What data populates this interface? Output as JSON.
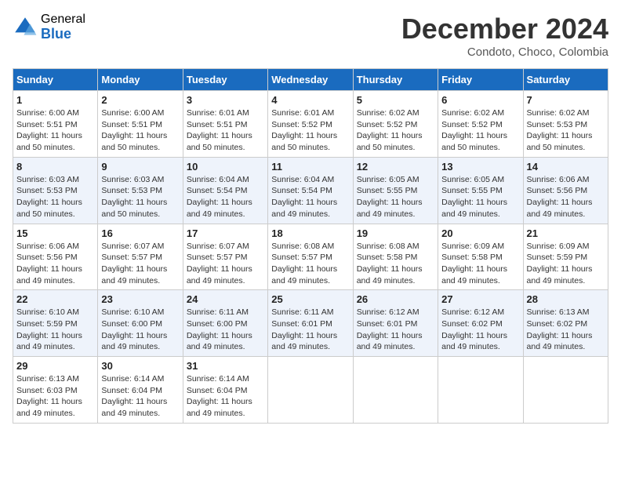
{
  "logo": {
    "general": "General",
    "blue": "Blue"
  },
  "header": {
    "month": "December 2024",
    "location": "Condoto, Choco, Colombia"
  },
  "weekdays": [
    "Sunday",
    "Monday",
    "Tuesday",
    "Wednesday",
    "Thursday",
    "Friday",
    "Saturday"
  ],
  "weeks": [
    [
      {
        "day": "1",
        "sunrise": "6:00 AM",
        "sunset": "5:51 PM",
        "daylight": "11 hours and 50 minutes."
      },
      {
        "day": "2",
        "sunrise": "6:00 AM",
        "sunset": "5:51 PM",
        "daylight": "11 hours and 50 minutes."
      },
      {
        "day": "3",
        "sunrise": "6:01 AM",
        "sunset": "5:51 PM",
        "daylight": "11 hours and 50 minutes."
      },
      {
        "day": "4",
        "sunrise": "6:01 AM",
        "sunset": "5:52 PM",
        "daylight": "11 hours and 50 minutes."
      },
      {
        "day": "5",
        "sunrise": "6:02 AM",
        "sunset": "5:52 PM",
        "daylight": "11 hours and 50 minutes."
      },
      {
        "day": "6",
        "sunrise": "6:02 AM",
        "sunset": "5:52 PM",
        "daylight": "11 hours and 50 minutes."
      },
      {
        "day": "7",
        "sunrise": "6:02 AM",
        "sunset": "5:53 PM",
        "daylight": "11 hours and 50 minutes."
      }
    ],
    [
      {
        "day": "8",
        "sunrise": "6:03 AM",
        "sunset": "5:53 PM",
        "daylight": "11 hours and 50 minutes."
      },
      {
        "day": "9",
        "sunrise": "6:03 AM",
        "sunset": "5:53 PM",
        "daylight": "11 hours and 50 minutes."
      },
      {
        "day": "10",
        "sunrise": "6:04 AM",
        "sunset": "5:54 PM",
        "daylight": "11 hours and 49 minutes."
      },
      {
        "day": "11",
        "sunrise": "6:04 AM",
        "sunset": "5:54 PM",
        "daylight": "11 hours and 49 minutes."
      },
      {
        "day": "12",
        "sunrise": "6:05 AM",
        "sunset": "5:55 PM",
        "daylight": "11 hours and 49 minutes."
      },
      {
        "day": "13",
        "sunrise": "6:05 AM",
        "sunset": "5:55 PM",
        "daylight": "11 hours and 49 minutes."
      },
      {
        "day": "14",
        "sunrise": "6:06 AM",
        "sunset": "5:56 PM",
        "daylight": "11 hours and 49 minutes."
      }
    ],
    [
      {
        "day": "15",
        "sunrise": "6:06 AM",
        "sunset": "5:56 PM",
        "daylight": "11 hours and 49 minutes."
      },
      {
        "day": "16",
        "sunrise": "6:07 AM",
        "sunset": "5:57 PM",
        "daylight": "11 hours and 49 minutes."
      },
      {
        "day": "17",
        "sunrise": "6:07 AM",
        "sunset": "5:57 PM",
        "daylight": "11 hours and 49 minutes."
      },
      {
        "day": "18",
        "sunrise": "6:08 AM",
        "sunset": "5:57 PM",
        "daylight": "11 hours and 49 minutes."
      },
      {
        "day": "19",
        "sunrise": "6:08 AM",
        "sunset": "5:58 PM",
        "daylight": "11 hours and 49 minutes."
      },
      {
        "day": "20",
        "sunrise": "6:09 AM",
        "sunset": "5:58 PM",
        "daylight": "11 hours and 49 minutes."
      },
      {
        "day": "21",
        "sunrise": "6:09 AM",
        "sunset": "5:59 PM",
        "daylight": "11 hours and 49 minutes."
      }
    ],
    [
      {
        "day": "22",
        "sunrise": "6:10 AM",
        "sunset": "5:59 PM",
        "daylight": "11 hours and 49 minutes."
      },
      {
        "day": "23",
        "sunrise": "6:10 AM",
        "sunset": "6:00 PM",
        "daylight": "11 hours and 49 minutes."
      },
      {
        "day": "24",
        "sunrise": "6:11 AM",
        "sunset": "6:00 PM",
        "daylight": "11 hours and 49 minutes."
      },
      {
        "day": "25",
        "sunrise": "6:11 AM",
        "sunset": "6:01 PM",
        "daylight": "11 hours and 49 minutes."
      },
      {
        "day": "26",
        "sunrise": "6:12 AM",
        "sunset": "6:01 PM",
        "daylight": "11 hours and 49 minutes."
      },
      {
        "day": "27",
        "sunrise": "6:12 AM",
        "sunset": "6:02 PM",
        "daylight": "11 hours and 49 minutes."
      },
      {
        "day": "28",
        "sunrise": "6:13 AM",
        "sunset": "6:02 PM",
        "daylight": "11 hours and 49 minutes."
      }
    ],
    [
      {
        "day": "29",
        "sunrise": "6:13 AM",
        "sunset": "6:03 PM",
        "daylight": "11 hours and 49 minutes."
      },
      {
        "day": "30",
        "sunrise": "6:14 AM",
        "sunset": "6:04 PM",
        "daylight": "11 hours and 49 minutes."
      },
      {
        "day": "31",
        "sunrise": "6:14 AM",
        "sunset": "6:04 PM",
        "daylight": "11 hours and 49 minutes."
      },
      null,
      null,
      null,
      null
    ]
  ]
}
